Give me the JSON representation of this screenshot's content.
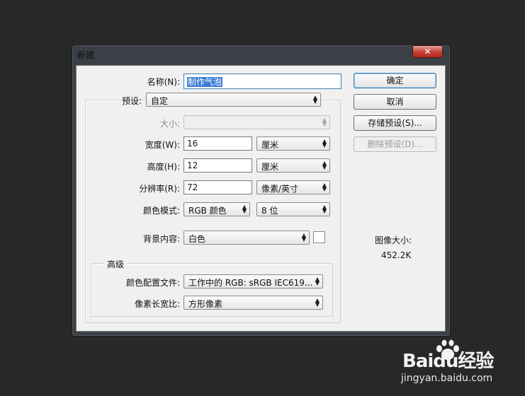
{
  "dialog": {
    "title": "新建",
    "close_label": "✕"
  },
  "fields": {
    "name_label": "名称(N):",
    "name_value": "制作气泡",
    "preset_label": "预设:",
    "preset_value": "自定",
    "size_label": "大小:",
    "size_value": "",
    "width_label": "宽度(W):",
    "width_value": "16",
    "width_unit": "厘米",
    "height_label": "高度(H):",
    "height_value": "12",
    "height_unit": "厘米",
    "resolution_label": "分辨率(R):",
    "resolution_value": "72",
    "resolution_unit": "像素/英寸",
    "color_mode_label": "颜色模式:",
    "color_mode_value": "RGB 颜色",
    "bit_depth_value": "8 位",
    "background_label": "背景内容:",
    "background_value": "白色"
  },
  "advanced": {
    "group_label": "高级",
    "color_profile_label": "颜色配置文件:",
    "color_profile_value": "工作中的 RGB: sRGB IEC619...",
    "pixel_aspect_label": "像素长宽比:",
    "pixel_aspect_value": "方形像素"
  },
  "buttons": {
    "ok": "确定",
    "cancel": "取消",
    "save_preset": "存储预设(S)...",
    "delete_preset": "删除预设(D)..."
  },
  "image_size": {
    "label": "图像大小:",
    "value": "452.2K"
  },
  "watermark": {
    "brand": "Baidu经验",
    "url": "jingyan.baidu.com"
  },
  "colors": {
    "background_swatch": "#ffffff",
    "selection_highlight": "#3a7bd5"
  }
}
